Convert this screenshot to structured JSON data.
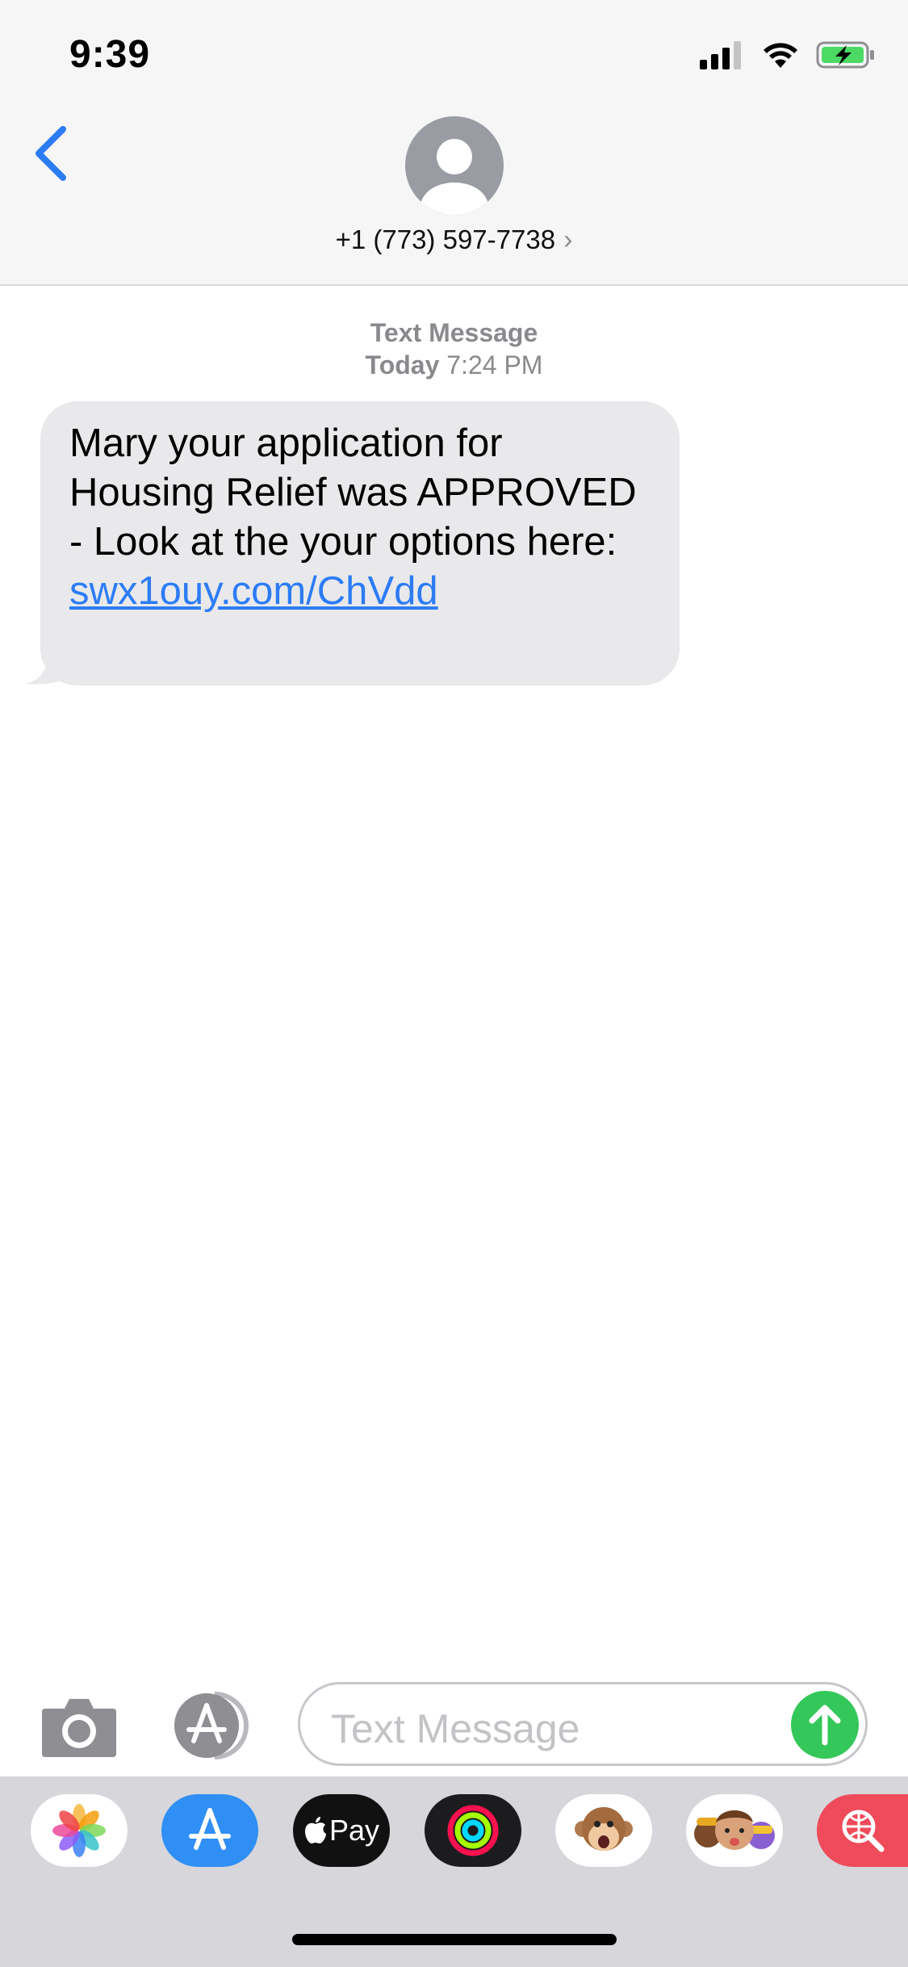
{
  "status_bar": {
    "time": "9:39"
  },
  "header": {
    "contact": "+1 (773) 597-7738",
    "chevron": "›"
  },
  "conversation": {
    "service": "Text Message",
    "day": "Today",
    "time": "7:24 PM",
    "message": {
      "text": "Mary your application for Housing Relief was APPROVED - Look at the your options here: ",
      "link": "swx1ouy.com/ChVdd"
    }
  },
  "input": {
    "placeholder": "Text Message"
  },
  "app_drawer": {
    "items": [
      "photos-app",
      "app-store",
      "apple-pay",
      "activity",
      "animoji",
      "memoji-stickers",
      "web-images"
    ],
    "pay_label": "Pay"
  },
  "colors": {
    "accent": "#2c7cf6",
    "bubble": "#e9e9eb",
    "send": "#34c759",
    "battery": "#4cd964",
    "drawer": "#d6d6db"
  }
}
